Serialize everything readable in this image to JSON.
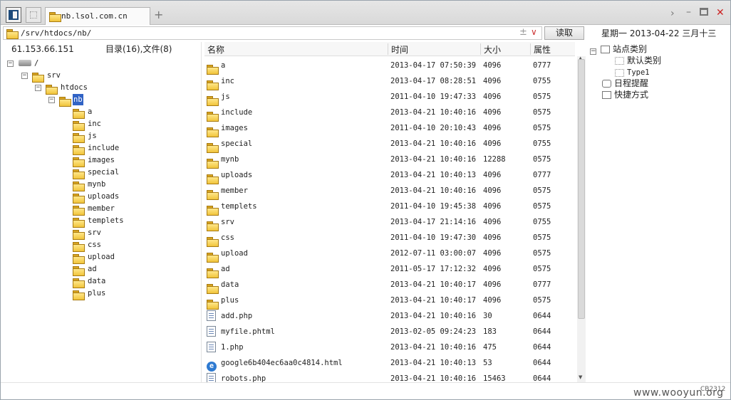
{
  "tab": {
    "title": "nb.lsol.com.cn"
  },
  "address": {
    "path": "/srv/htdocs/nb/",
    "read_label": "读取",
    "plus_minus": "±",
    "dropdown": "∨"
  },
  "date": "星期一 2013-04-22 三月十三",
  "left": {
    "ip": "61.153.66.151",
    "summary": "目录(16),文件(8)"
  },
  "tree": {
    "root": "/",
    "srv": "srv",
    "htdocs": "htdocs",
    "nb": "nb",
    "children": [
      "a",
      "inc",
      "js",
      "include",
      "images",
      "special",
      "mynb",
      "uploads",
      "member",
      "templets",
      "srv",
      "css",
      "upload",
      "ad",
      "data",
      "plus"
    ]
  },
  "columns": {
    "name": "名称",
    "time": "时间",
    "size": "大小",
    "attr": "属性"
  },
  "files": [
    {
      "name": "a",
      "time": "2013-04-17 07:50:39",
      "size": "4096",
      "attr": "0777",
      "icon": "folder-icon"
    },
    {
      "name": "inc",
      "time": "2013-04-17 08:28:51",
      "size": "4096",
      "attr": "0755",
      "icon": "folder-icon"
    },
    {
      "name": "js",
      "time": "2011-04-10 19:47:33",
      "size": "4096",
      "attr": "0575",
      "icon": "folder-icon"
    },
    {
      "name": "include",
      "time": "2013-04-21 10:40:16",
      "size": "4096",
      "attr": "0575",
      "icon": "folder-icon"
    },
    {
      "name": "images",
      "time": "2011-04-10 20:10:43",
      "size": "4096",
      "attr": "0575",
      "icon": "folder-icon"
    },
    {
      "name": "special",
      "time": "2013-04-21 10:40:16",
      "size": "4096",
      "attr": "0755",
      "icon": "folder-icon"
    },
    {
      "name": "mynb",
      "time": "2013-04-21 10:40:16",
      "size": "12288",
      "attr": "0575",
      "icon": "folder-icon"
    },
    {
      "name": "uploads",
      "time": "2013-04-21 10:40:13",
      "size": "4096",
      "attr": "0777",
      "icon": "folder-icon"
    },
    {
      "name": "member",
      "time": "2013-04-21 10:40:16",
      "size": "4096",
      "attr": "0575",
      "icon": "folder-icon"
    },
    {
      "name": "templets",
      "time": "2011-04-10 19:45:38",
      "size": "4096",
      "attr": "0575",
      "icon": "folder-icon"
    },
    {
      "name": "srv",
      "time": "2013-04-17 21:14:16",
      "size": "4096",
      "attr": "0755",
      "icon": "folder-icon"
    },
    {
      "name": "css",
      "time": "2011-04-10 19:47:30",
      "size": "4096",
      "attr": "0575",
      "icon": "folder-icon"
    },
    {
      "name": "upload",
      "time": "2012-07-11 03:00:07",
      "size": "4096",
      "attr": "0575",
      "icon": "folder-icon"
    },
    {
      "name": "ad",
      "time": "2011-05-17 17:12:32",
      "size": "4096",
      "attr": "0575",
      "icon": "folder-icon"
    },
    {
      "name": "data",
      "time": "2013-04-21 10:40:17",
      "size": "4096",
      "attr": "0777",
      "icon": "folder-icon"
    },
    {
      "name": "plus",
      "time": "2013-04-21 10:40:17",
      "size": "4096",
      "attr": "0575",
      "icon": "folder-icon"
    },
    {
      "name": "add.php",
      "time": "2013-04-21 10:40:16",
      "size": "30",
      "attr": "0644",
      "icon": "file-icon"
    },
    {
      "name": "myfile.phtml",
      "time": "2013-02-05 09:24:23",
      "size": "183",
      "attr": "0644",
      "icon": "file-icon"
    },
    {
      "name": "1.php",
      "time": "2013-04-21 10:40:16",
      "size": "475",
      "attr": "0644",
      "icon": "file-icon"
    },
    {
      "name": "google6b404ec6aa0c4814.html",
      "time": "2013-04-21 10:40:13",
      "size": "53",
      "attr": "0644",
      "icon": "ie-icon"
    },
    {
      "name": "robots.php",
      "time": "2013-04-21 10:40:16",
      "size": "15463",
      "attr": "0644",
      "icon": "file-icon"
    }
  ],
  "right": {
    "site_category": "站点类别",
    "default_category": "默认类别",
    "type1": "Type1",
    "schedule": "日程提醒",
    "shortcut": "快捷方式"
  },
  "watermark": "www.wooyun.org",
  "watermark_id": "CB2312"
}
